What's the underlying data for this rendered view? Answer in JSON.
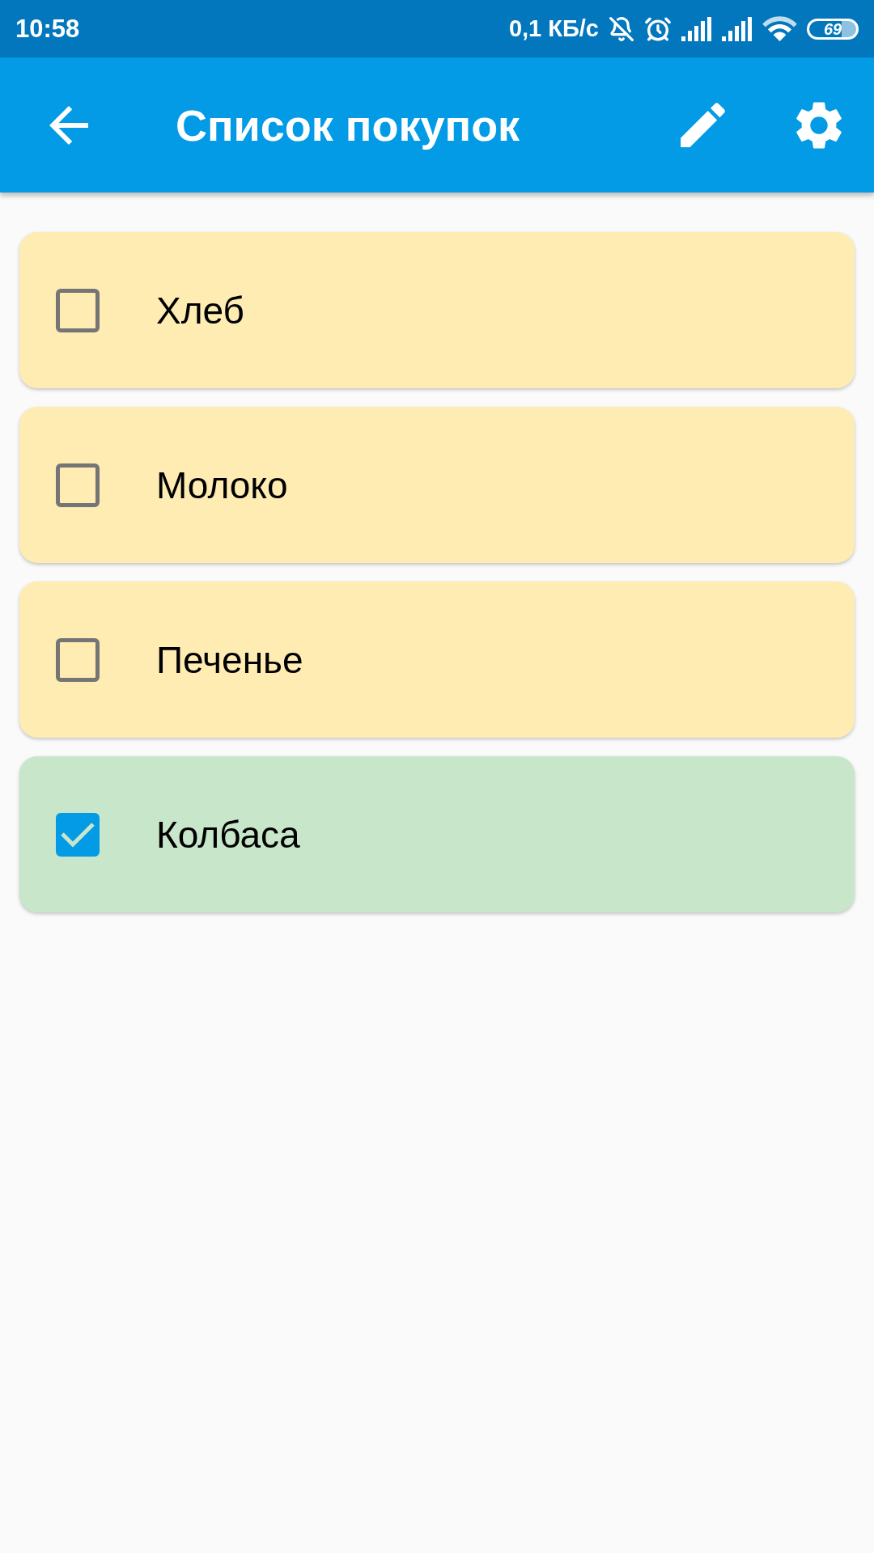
{
  "status_bar": {
    "time": "10:58",
    "network_speed": "0,1 КБ/с",
    "battery": "69"
  },
  "app_bar": {
    "title": "Список покупок"
  },
  "items": [
    {
      "label": "Хлеб",
      "checked": false
    },
    {
      "label": "Молоко",
      "checked": false
    },
    {
      "label": "Печенье",
      "checked": false
    },
    {
      "label": "Колбаса",
      "checked": true
    }
  ]
}
